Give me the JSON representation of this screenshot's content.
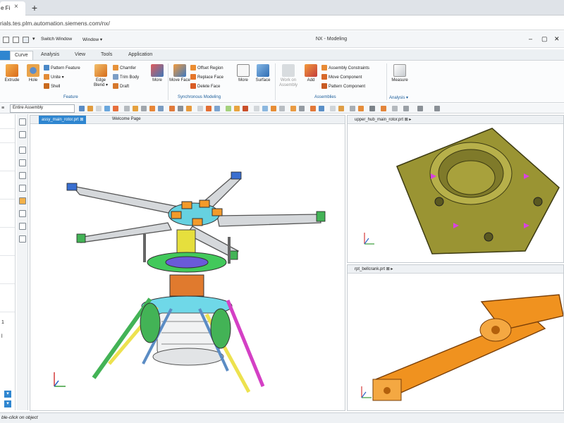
{
  "browser": {
    "tab_title": "e Fi",
    "tab_close": "×",
    "new_tab": "+",
    "url": "rials.tes.plm.automation.siemens.com/nx/"
  },
  "titlebar": {
    "switch_window": "Switch Window",
    "window_menu": "Window ▾",
    "app_title": "NX - Modeling",
    "minimize": "–",
    "maximize": "▢",
    "close": "✕"
  },
  "ribbon_tabs": [
    "Curve",
    "Analysis",
    "View",
    "Tools",
    "Application"
  ],
  "ribbon": {
    "feature_group": {
      "label": "Feature",
      "extrude": "Extrude",
      "hole": "Hole",
      "pattern_feature": "Pattern Feature",
      "unite": "Unite ▾",
      "shell": "Shell"
    },
    "edge_group": {
      "edge_blend": "Edge Blend ▾",
      "chamfer": "Chamfer",
      "trim_body": "Trim Body",
      "draft": "Draft",
      "more": "More"
    },
    "synch_group": {
      "label": "Synchronous Modeling",
      "move_face": "Move Face",
      "offset_region": "Offset Region",
      "replace_face": "Replace Face",
      "delete_face": "Delete Face",
      "more": "More"
    },
    "surface": "Surface",
    "assemblies_group": {
      "label": "Assemblies",
      "work_on_assembly": "Work on Assembly",
      "add": "Add",
      "assembly_constraints": "Assembly Constraints",
      "move_component": "Move Component",
      "pattern_component": "Pattern Component"
    },
    "analysis_group": {
      "label": "Analysis ▾",
      "measure": "Measure"
    }
  },
  "selection_bar": {
    "filter_value": "Entire Assembly"
  },
  "graphics": {
    "main_tab": "assy_main_rotor.prt",
    "welcome_tab": "Welcome Page",
    "top_right_tab": "upper_hub_main_rotor.prt",
    "bottom_right_tab": "rpt_bellcrank.prt"
  },
  "status": {
    "text": "ble-click on object"
  },
  "left_nav": {
    "mark_1": "1",
    "mark_2": "l"
  },
  "colors": {
    "accent": "#2f86d0",
    "hub": "#9a9433",
    "bellcrank": "#f0921f",
    "rotor_blade": "#d5d8db"
  }
}
